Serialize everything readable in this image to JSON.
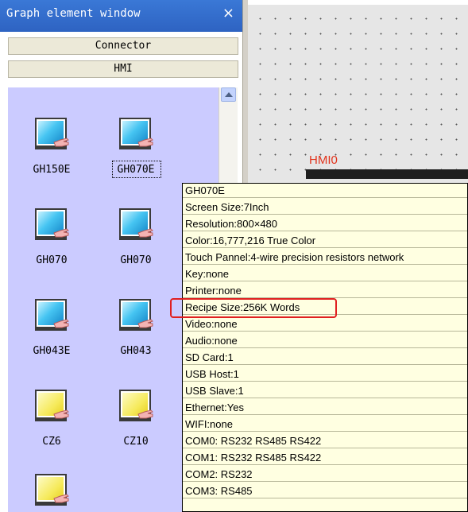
{
  "panel": {
    "title": "Graph element window",
    "close_glyph": "×",
    "categories": [
      "Connector",
      "HMI"
    ]
  },
  "items": [
    {
      "label": "GH150E",
      "icon": "hmi-touch-blue-icon"
    },
    {
      "label": "GH070E",
      "icon": "hmi-touch-blue-icon",
      "selected": true
    },
    {
      "label": "GH070",
      "icon": "hmi-touch-blue-icon"
    },
    {
      "label": "GH070",
      "icon": "hmi-touch-blue-icon"
    },
    {
      "label": "GH043E",
      "icon": "hmi-touch-blue-icon"
    },
    {
      "label": "GH043",
      "icon": "hmi-touch-blue-icon"
    },
    {
      "label": "CZ6",
      "icon": "hmi-touch-yellow-icon"
    },
    {
      "label": "CZ10",
      "icon": "hmi-touch-yellow-icon"
    },
    {
      "label": "",
      "icon": "hmi-touch-yellow-icon"
    }
  ],
  "canvas": {
    "hmi_label": "HMI0"
  },
  "tooltip": {
    "lines": [
      "GH070E",
      "Screen Size:7Inch",
      "Resolution:800×480",
      "Color:16,777,216 True Color",
      "Touch Pannel:4-wire precision resistors network",
      "Key:none",
      "Printer:none",
      "Recipe Size:256K Words",
      "Video:none",
      "Audio:none",
      "SD Card:1",
      "USB Host:1",
      "USB Slave:1",
      "Ethernet:Yes",
      "WIFI:none",
      "COM0: RS232 RS485 RS422",
      "COM1: RS232 RS485 RS422",
      "COM2: RS232",
      "COM3: RS485"
    ],
    "highlighted_line": "Recipe Size:256K Words"
  },
  "colors": {
    "title_bar": "#2e63c2",
    "list_bg": "#cbcbff",
    "tooltip_bg": "#ffffe1",
    "highlight": "#e02020",
    "hmi_label": "#e2331c"
  }
}
